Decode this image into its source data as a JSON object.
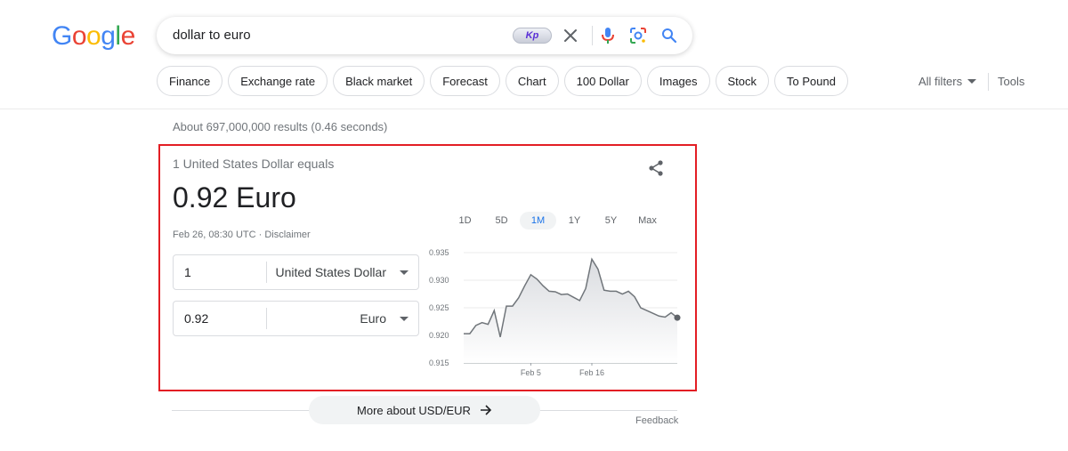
{
  "logo": {
    "letters": [
      "G",
      "o",
      "o",
      "g",
      "l",
      "e"
    ],
    "colors": [
      "#4285F4",
      "#EA4335",
      "#FBBC05",
      "#4285F4",
      "#34A853",
      "#EA4335"
    ]
  },
  "search": {
    "query": "dollar to euro",
    "badge": "Kp"
  },
  "chips": [
    "Finance",
    "Exchange rate",
    "Black market",
    "Forecast",
    "Chart",
    "100 Dollar",
    "Images",
    "Stock",
    "To Pound"
  ],
  "filters": {
    "all_filters": "All filters",
    "tools": "Tools"
  },
  "results_count": "About 697,000,000 results (0.46 seconds)",
  "converter": {
    "equals_label": "1 United States Dollar equals",
    "big_value": "0.92 Euro",
    "timestamp": "Feb 26, 08:30 UTC · Disclaimer",
    "from": {
      "amount": "1",
      "currency": "United States Dollar"
    },
    "to": {
      "amount": "0.92",
      "currency": "Euro"
    },
    "ranges": [
      "1D",
      "5D",
      "1M",
      "1Y",
      "5Y",
      "Max"
    ],
    "active_range": "1M"
  },
  "chart_data": {
    "type": "area",
    "y_ticks": [
      "0.935",
      "0.930",
      "0.925",
      "0.920",
      "0.915"
    ],
    "ylim": [
      0.915,
      0.935
    ],
    "x_tick_labels": [
      "Feb 5",
      "Feb 16"
    ],
    "x_tick_index": [
      11,
      21
    ],
    "values": [
      0.9203,
      0.9203,
      0.9218,
      0.9223,
      0.922,
      0.9245,
      0.9197,
      0.9253,
      0.9253,
      0.9268,
      0.929,
      0.931,
      0.9302,
      0.929,
      0.928,
      0.9279,
      0.9274,
      0.9275,
      0.9269,
      0.9263,
      0.9285,
      0.9338,
      0.932,
      0.9282,
      0.928,
      0.928,
      0.9275,
      0.928,
      0.927,
      0.925,
      0.9245,
      0.924,
      0.9235,
      0.9233,
      0.9241,
      0.9232
    ],
    "line_color": "#70757a",
    "fill_color": "#e8eaed"
  },
  "more_about": "More about USD/EUR",
  "feedback": "Feedback"
}
